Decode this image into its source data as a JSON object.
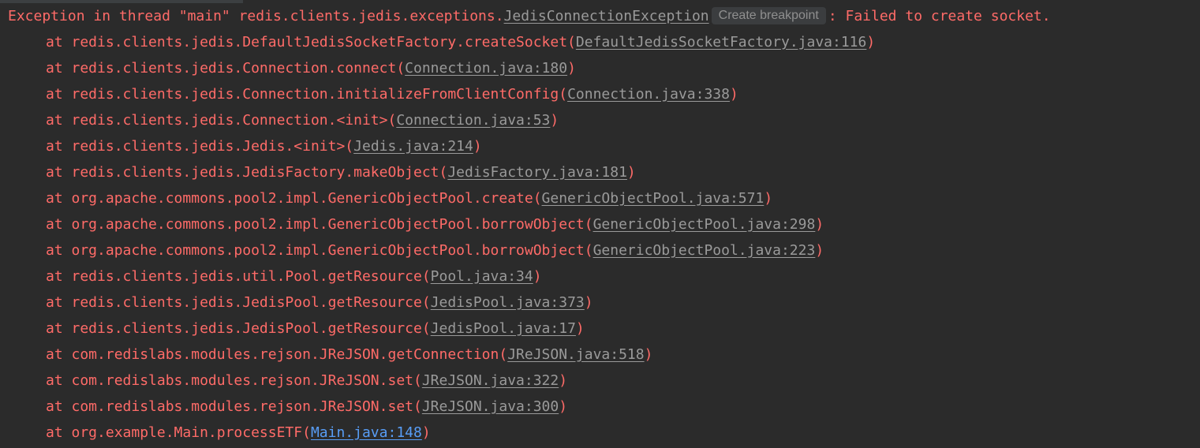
{
  "exception": {
    "prefix": "Exception in thread \"main\" redis.clients.jedis.exceptions.",
    "class_link": "JedisConnectionException",
    "hint": "Create breakpoint",
    "message": ": Failed to create socket."
  },
  "frames": [
    {
      "method": "at redis.clients.jedis.DefaultJedisSocketFactory.createSocket(",
      "location": "DefaultJedisSocketFactory.java:116",
      "close": ")"
    },
    {
      "method": "at redis.clients.jedis.Connection.connect(",
      "location": "Connection.java:180",
      "close": ")"
    },
    {
      "method": "at redis.clients.jedis.Connection.initializeFromClientConfig(",
      "location": "Connection.java:338",
      "close": ")"
    },
    {
      "method": "at redis.clients.jedis.Connection.<init>(",
      "location": "Connection.java:53",
      "close": ")"
    },
    {
      "method": "at redis.clients.jedis.Jedis.<init>(",
      "location": "Jedis.java:214",
      "close": ")"
    },
    {
      "method": "at redis.clients.jedis.JedisFactory.makeObject(",
      "location": "JedisFactory.java:181",
      "close": ")"
    },
    {
      "method": "at org.apache.commons.pool2.impl.GenericObjectPool.create(",
      "location": "GenericObjectPool.java:571",
      "close": ")"
    },
    {
      "method": "at org.apache.commons.pool2.impl.GenericObjectPool.borrowObject(",
      "location": "GenericObjectPool.java:298",
      "close": ")"
    },
    {
      "method": "at org.apache.commons.pool2.impl.GenericObjectPool.borrowObject(",
      "location": "GenericObjectPool.java:223",
      "close": ")"
    },
    {
      "method": "at redis.clients.jedis.util.Pool.getResource(",
      "location": "Pool.java:34",
      "close": ")"
    },
    {
      "method": "at redis.clients.jedis.JedisPool.getResource(",
      "location": "JedisPool.java:373",
      "close": ")"
    },
    {
      "method": "at redis.clients.jedis.JedisPool.getResource(",
      "location": "JedisPool.java:17",
      "close": ")"
    },
    {
      "method": "at com.redislabs.modules.rejson.JReJSON.getConnection(",
      "location": "JReJSON.java:518",
      "close": ")"
    },
    {
      "method": "at com.redislabs.modules.rejson.JReJSON.set(",
      "location": "JReJSON.java:322",
      "close": ")"
    },
    {
      "method": "at com.redislabs.modules.rejson.JReJSON.set(",
      "location": "JReJSON.java:300",
      "close": ")"
    },
    {
      "method": "at org.example.Main.processETF(",
      "location": "Main.java:148",
      "close": ")"
    }
  ],
  "colors": {
    "background": "#2b2b2b",
    "error_text": "#ff6b68",
    "library_link": "#9a9a9a",
    "user_link": "#589df6",
    "hint_background": "#3b3d3f"
  }
}
